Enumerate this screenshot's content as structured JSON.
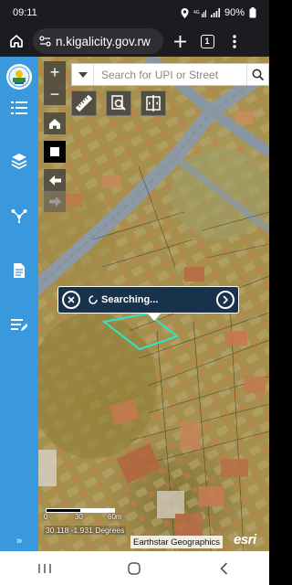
{
  "status": {
    "time": "09:11",
    "battery": "90%"
  },
  "browser": {
    "url": "n.kigalicity.gov.rw",
    "tab_count": "1"
  },
  "map": {
    "search_placeholder": "Search for UPI or Street",
    "zoom_in": "+",
    "zoom_out": "−",
    "popup_text": "Searching...",
    "scale_labels": [
      "0",
      "30",
      "60m"
    ],
    "coordinates": "30.118 -1.931 Degrees",
    "attribution": "Earthstar Geographics",
    "esri_logo": "esri"
  },
  "sidebar": {
    "expand_label": "»",
    "items": [
      "list-icon",
      "layers-icon",
      "share-icon",
      "document-icon",
      "notes-icon"
    ]
  },
  "colors": {
    "sidebar": "#3a99dd",
    "popup": "#17324a",
    "parcel_outline": "#2ee6c7"
  }
}
